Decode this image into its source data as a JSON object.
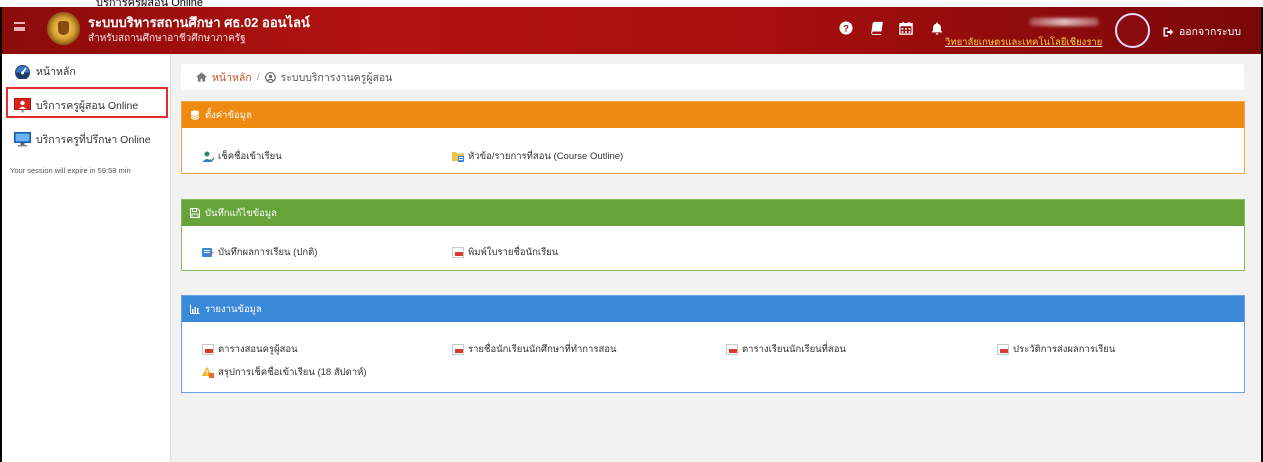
{
  "header": {
    "title": "ระบบบริหารสถานศึกษา ศธ.02 ออนไลน์",
    "subtitle": "สำหรับสถานศึกษาอาชีวศึกษาภาครัฐ",
    "college": "วิทยาลัยเกษตรและเทคโนโลยีเชียงราย",
    "logout_label": "ออกจากระบบ",
    "icons": [
      "menu-icon",
      "help-icon",
      "book-icon",
      "calendar-icon",
      "bell-icon",
      "sign-out-icon"
    ]
  },
  "sidebar": {
    "items": [
      {
        "label": "หน้าหลัก",
        "icon": "dashboard-icon"
      },
      {
        "label": "บริการครูผู้สอน Online",
        "icon": "teacher-icon"
      },
      {
        "label": "บริการครูที่ปรึกษา Online",
        "icon": "monitor-icon"
      }
    ],
    "session_text": "Your session will expire in 59:58 min"
  },
  "breadcrumb": {
    "home": "หน้าหลัก",
    "separator": "/",
    "current": "ระบบบริการงานครูผู้สอน"
  },
  "panels": {
    "settings": {
      "title": "ตั้งค่าข้อมูล",
      "color": "#ef8a10",
      "links": [
        "เช็คชื่อเข้าเรียน",
        "หัวข้อ/รายการที่สอน (Course Outline)"
      ]
    },
    "record": {
      "title": "บันทึกแก้ไขข้อมูล",
      "color": "#66a338",
      "links": [
        "บันทึกผลการเรียน (ปกติ)",
        "พิมพ์ใบรายชื่อนักเรียน"
      ]
    },
    "report": {
      "title": "รายงานข้อมูล",
      "color": "#3a89d8",
      "links": [
        "ตารางสอนครูผู้สอน",
        "รายชื่อนักเรียนนักศึกษาที่ทำการสอน",
        "ตารางเรียนนักเรียนที่สอน",
        "ประวัติการส่งผลการเรียน",
        "สรุปการเช็คชื่อเข้าเรียน (18 สัปดาห์)"
      ]
    }
  }
}
